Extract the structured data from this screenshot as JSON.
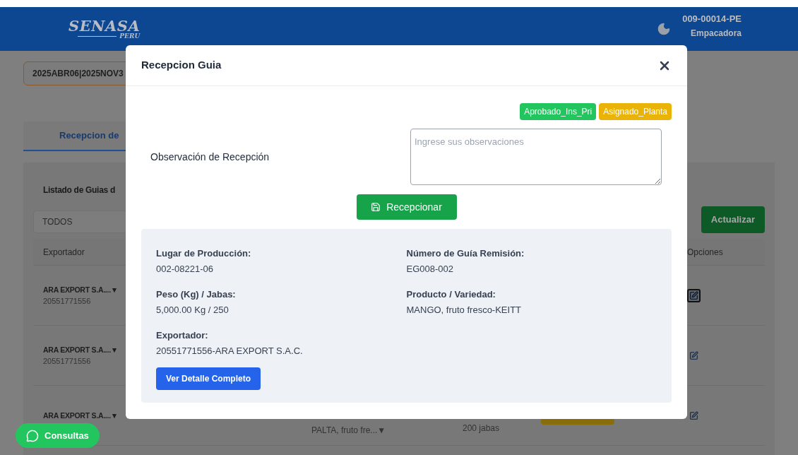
{
  "header": {
    "logo": {
      "title": "SENASA",
      "subtitle": "PERU"
    },
    "user": {
      "code": "009-00014-PE",
      "role": "Empacadora"
    }
  },
  "filter": {
    "value": "2025ABR06|2025NOV3"
  },
  "tabs": [
    {
      "label": "Recepcion de",
      "selected": true
    }
  ],
  "panel": {
    "title": "Listado de Guias d",
    "select": "TODOS",
    "refresh_button": "Actualizar",
    "columns": {
      "column_1": "Exportador",
      "column_last": "Opciones"
    },
    "rows": [
      {
        "exporter": "ARA EXPORT S.A....▼",
        "ruc": "20551771556",
        "selected": true
      },
      {
        "exporter": "ARA EXPORT S.A....▼",
        "ruc": "20551771556",
        "selected": false
      },
      {
        "exporter": "ARA EXPORT S.A....▼",
        "product": "PALTA, fruto fre...▼",
        "jabas": "200 jabas",
        "color": "#8a6d0b",
        "selected": false
      }
    ]
  },
  "modal": {
    "title": "Recepcion Guia",
    "statuses": [
      {
        "label": "Aprobado_Ins_Pri",
        "color": "#22c55e"
      },
      {
        "label": "Asignado_Planta",
        "color": "#eab308"
      }
    ],
    "observation_label": "Observación de Recepción",
    "observation_placeholder": "Ingrese sus observaciones",
    "submit_button": "Recepcionar",
    "details": [
      {
        "label": "Lugar de Producción:",
        "value": "002-08221-06"
      },
      {
        "label": "Número de Guía Remisión:",
        "value": "EG008-002"
      },
      {
        "label": "Peso (Kg) / Jabas:",
        "value": "5,000.00 Kg / 250"
      },
      {
        "label": "Producto / Variedad:",
        "value": "MANGO, fruto fresco-KEITT"
      },
      {
        "label": "Exportador:",
        "value": "20551771556-ARA EXPORT S.A.C."
      }
    ],
    "detail_button": "Ver Detalle Completo"
  },
  "chat_button": "Consultas"
}
